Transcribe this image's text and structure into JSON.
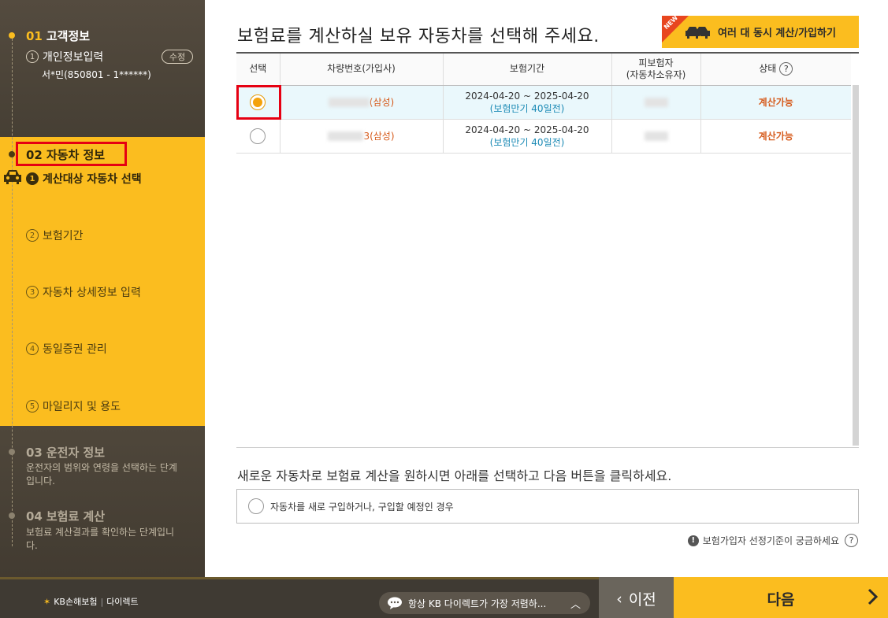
{
  "sidebar": {
    "step1": {
      "num": "01",
      "title": "고객정보",
      "sub_num": "1",
      "sub_label": "개인정보입력",
      "edit": "수정",
      "user": "서*민(850801 - 1******)"
    },
    "step2": {
      "num": "02",
      "title": "자동차 정보",
      "items": [
        {
          "num": "1",
          "label": "계산대상 자동차 선택"
        },
        {
          "num": "2",
          "label": "보험기간"
        },
        {
          "num": "3",
          "label": "자동차 상세정보 입력"
        },
        {
          "num": "4",
          "label": "동일증권 관리"
        },
        {
          "num": "5",
          "label": "마일리지 및 용도"
        }
      ]
    },
    "step3": {
      "num": "03",
      "title": "운전자 정보",
      "desc": "운전자의 범위와 연령을 선택하는 단계입니다."
    },
    "step4": {
      "num": "04",
      "title": "보험료 계산",
      "desc": "보험료 계산결과를 확인하는 단계입니다."
    }
  },
  "main": {
    "title": "보험료를 계산하실 보유 자동차를 선택해 주세요.",
    "multi_button": "여러 대 동시 계산/가입하기",
    "new_badge": "NEW",
    "table": {
      "headers": [
        "선택",
        "차량번호(가입사)",
        "보험기간",
        "피보험자\n(자동차소유자)",
        "상태"
      ],
      "help": "?",
      "rows": [
        {
          "selected": true,
          "insurer": "(삼성)",
          "period": "2024-04-20 ~ 2025-04-20",
          "maturity": "(보험만기 40일전)",
          "status": "계산가능"
        },
        {
          "selected": false,
          "insurer": "3(삼성)",
          "period": "2024-04-20 ~ 2025-04-20",
          "maturity": "(보험만기 40일전)",
          "status": "계산가능"
        }
      ]
    },
    "new_car_msg": "새로운 자동차로 보험료 계산을 원하시면 아래를 선택하고 다음 버튼을 클릭하세요.",
    "new_car_option": "자동차를 새로 구입하거나, 구입할 예정인 경우",
    "criteria": "보험가입자 선정기준이 궁금하세요"
  },
  "footer": {
    "brand": "KB손해보험",
    "brand_sub": "다이렉트",
    "ticker": "항상 KB 다이렉트가 가장 저렴하...",
    "prev": "이전",
    "next": "다음"
  }
}
